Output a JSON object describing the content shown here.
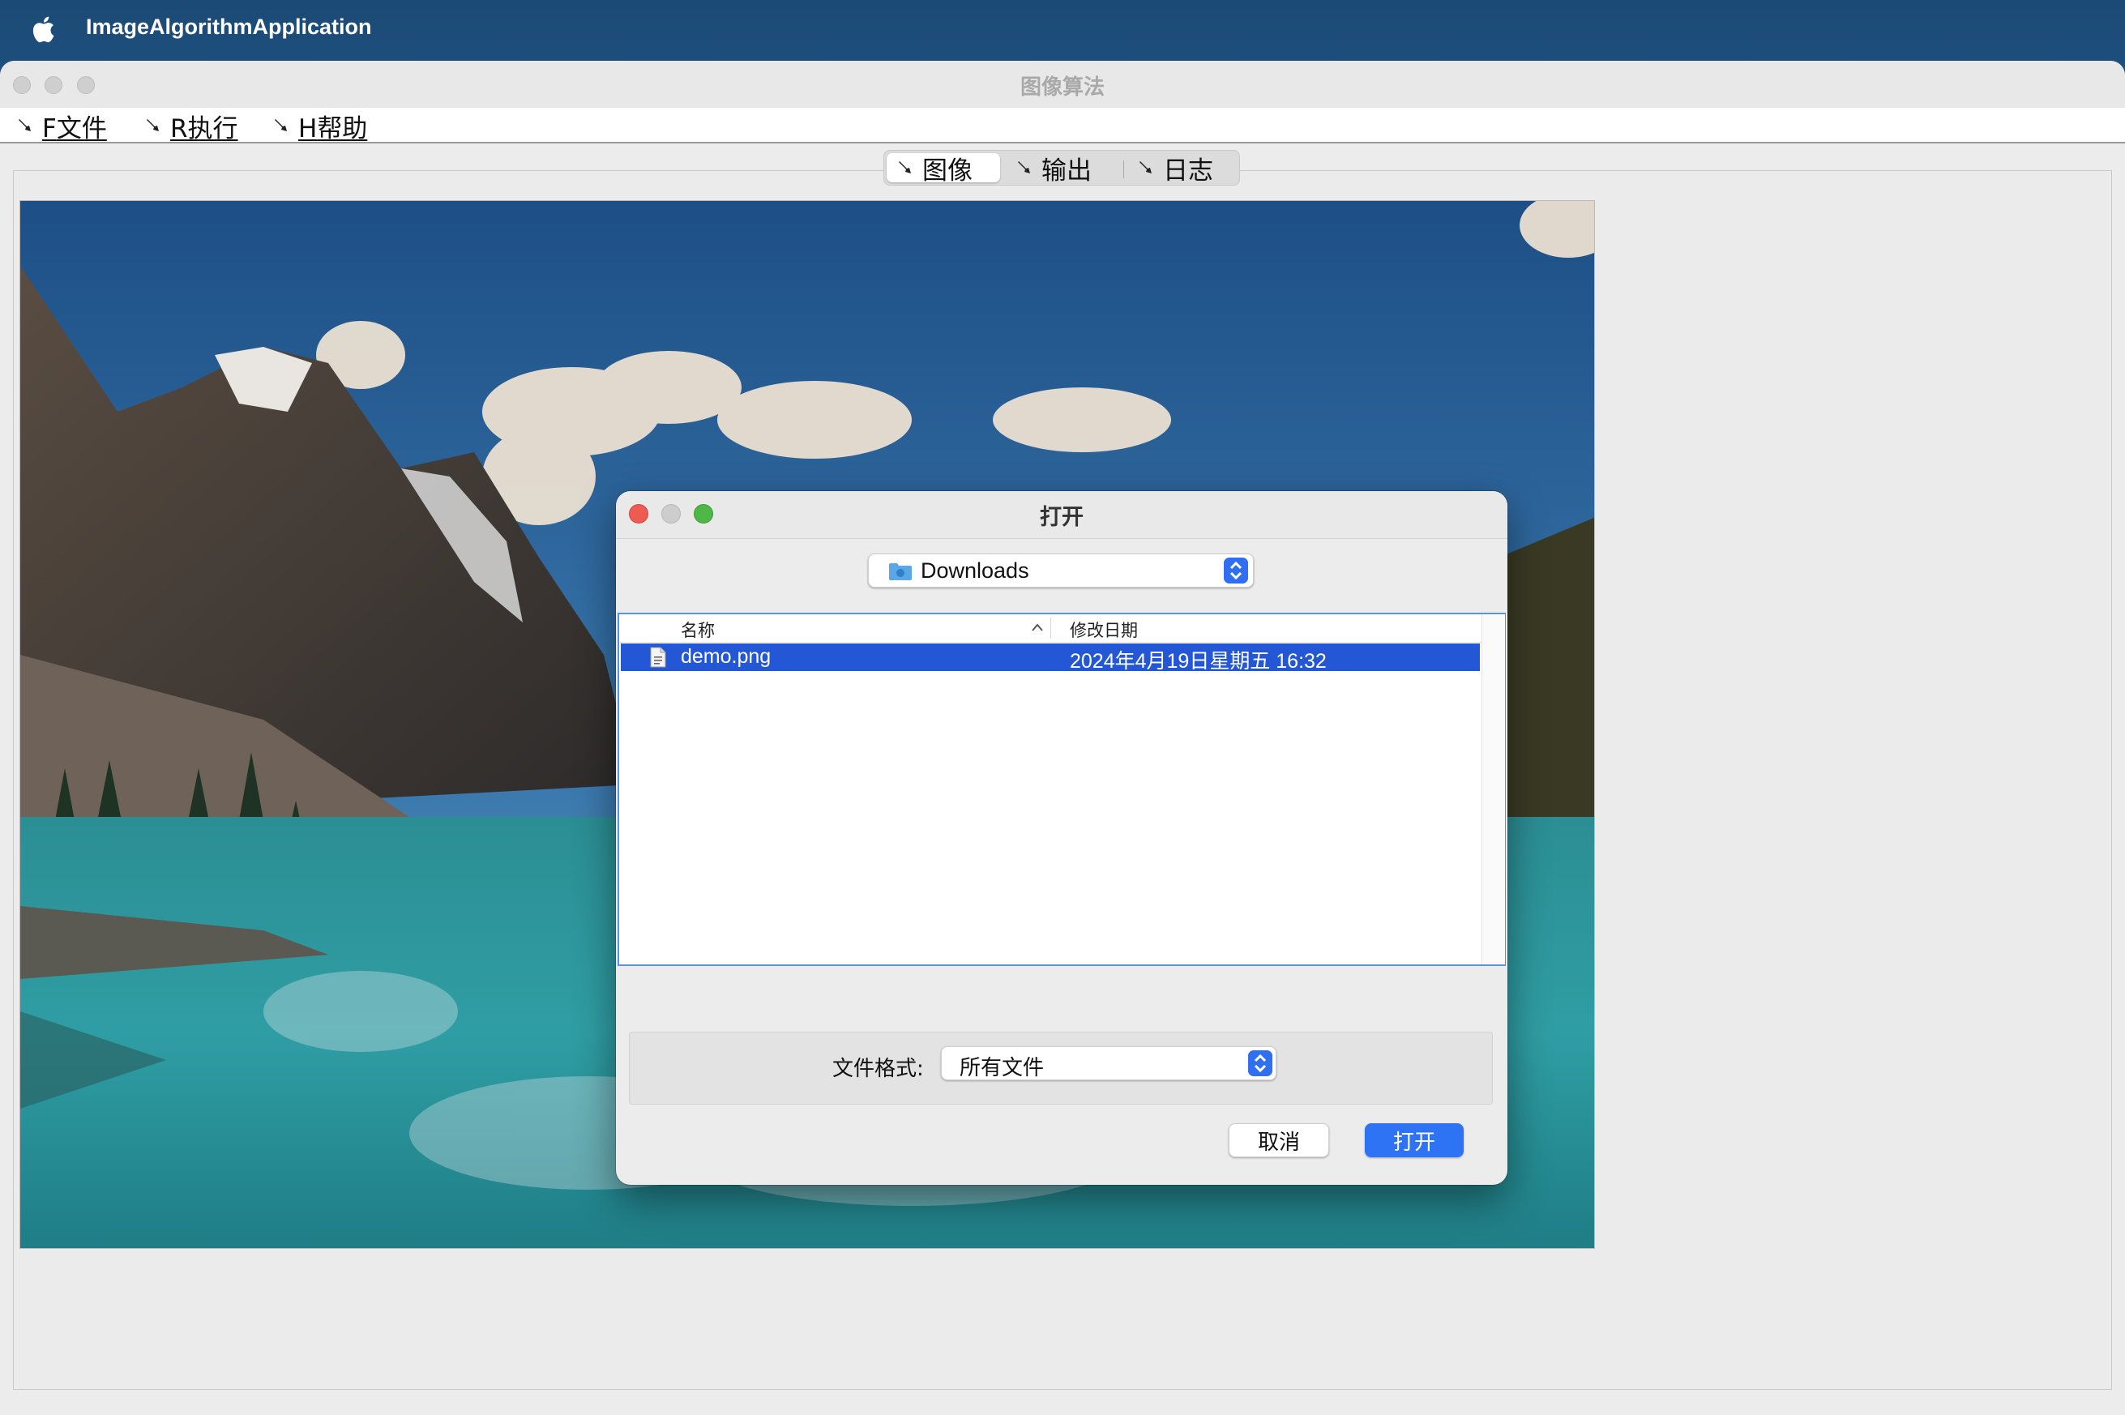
{
  "menubar": {
    "app_name": "ImageAlgorithmApplication",
    "apple_icon": "apple-logo-icon"
  },
  "window": {
    "title": "图像算法",
    "menus": [
      {
        "mnemonic": "F",
        "label": "文件"
      },
      {
        "mnemonic": "R",
        "label": "执行"
      },
      {
        "mnemonic": "H",
        "label": "帮助"
      }
    ],
    "tabs": [
      {
        "label": "图像",
        "active": true
      },
      {
        "label": "输出",
        "active": false
      },
      {
        "label": "日志",
        "active": false
      }
    ],
    "menu_icon": "pin-icon"
  },
  "dialog": {
    "title": "打开",
    "location": "Downloads",
    "columns": {
      "name": "名称",
      "date": "修改日期"
    },
    "files": [
      {
        "name": "demo.png",
        "modified": "2024年4月19日星期五 16:32",
        "selected": true
      }
    ],
    "format_label": "文件格式:",
    "format_value": "所有文件",
    "cancel_label": "取消",
    "open_label": "打开",
    "colors": {
      "accent": "#2f73f5",
      "selection": "#2457d6",
      "close": "#ee5b53",
      "zoom": "#4fb746"
    }
  }
}
